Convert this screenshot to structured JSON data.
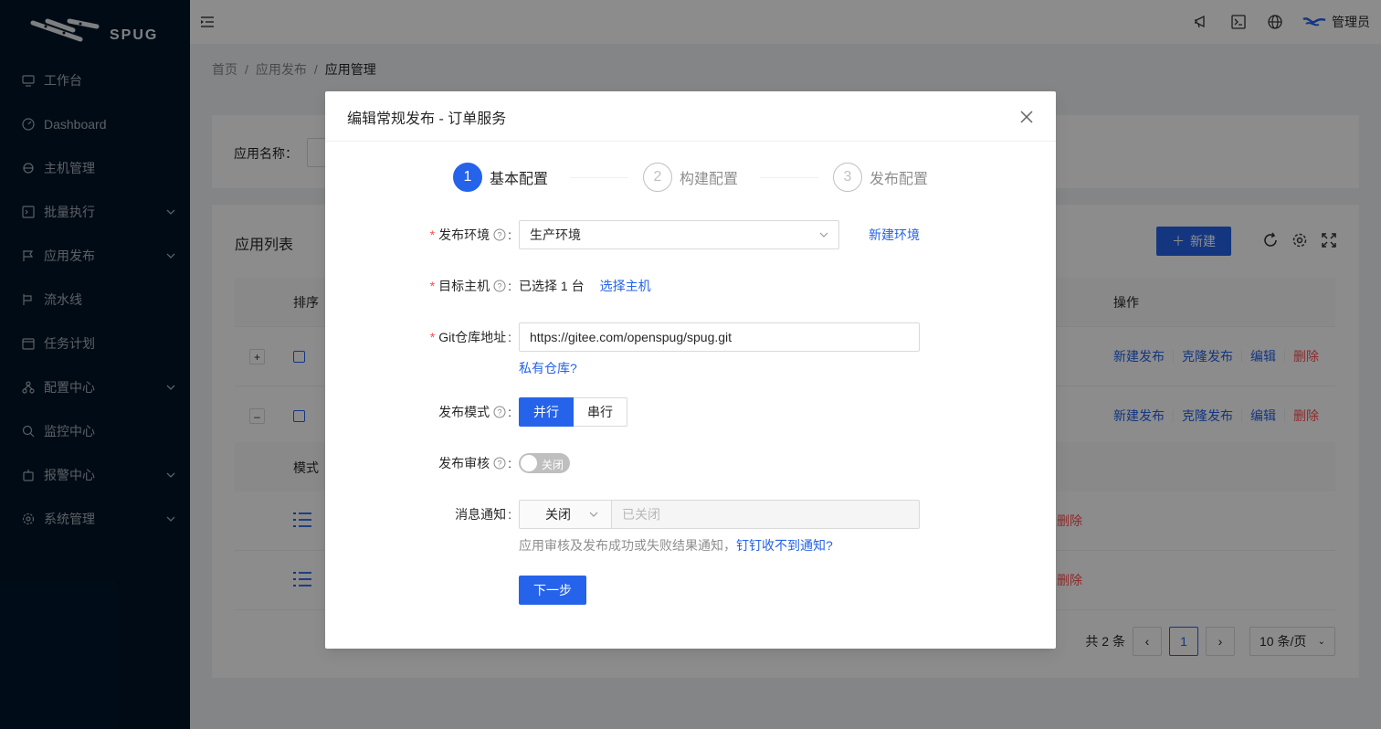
{
  "app": {
    "logo_text": "SPUG"
  },
  "sidebar": {
    "items": [
      {
        "label": "工作台",
        "icon": "desktop-icon",
        "has_arrow": false
      },
      {
        "label": "Dashboard",
        "icon": "dashboard-icon",
        "has_arrow": false
      },
      {
        "label": "主机管理",
        "icon": "cloud-server-icon",
        "has_arrow": false
      },
      {
        "label": "批量执行",
        "icon": "code-icon",
        "has_arrow": true
      },
      {
        "label": "应用发布",
        "icon": "flag-icon",
        "has_arrow": true
      },
      {
        "label": "流水线",
        "icon": "pipeline-icon",
        "has_arrow": false
      },
      {
        "label": "任务计划",
        "icon": "schedule-icon",
        "has_arrow": false
      },
      {
        "label": "配置中心",
        "icon": "deployment-icon",
        "has_arrow": true
      },
      {
        "label": "监控中心",
        "icon": "monitor-icon",
        "has_arrow": false
      },
      {
        "label": "报警中心",
        "icon": "alert-icon",
        "has_arrow": true
      },
      {
        "label": "系统管理",
        "icon": "setting-icon",
        "has_arrow": true
      }
    ]
  },
  "header": {
    "user": "管理员"
  },
  "breadcrumb": {
    "items": [
      "首页",
      "应用发布",
      "应用管理"
    ]
  },
  "search": {
    "label": "应用名称："
  },
  "list": {
    "title": "应用列表",
    "new_label": "新建",
    "col_sort": "排序",
    "col_ops": "操作",
    "row_actions": [
      "新建发布",
      "克隆发布",
      "编辑",
      "删除"
    ],
    "row_expand": [
      "+",
      "–"
    ],
    "sub_col_mode": "模式",
    "sub_delete": "删除",
    "pager": {
      "total": "共 2 条",
      "page": "1",
      "size": "10 条/页"
    }
  },
  "modal": {
    "title": "编辑常规发布 - 订单服务",
    "steps": [
      {
        "num": "1",
        "title": "基本配置",
        "active": true
      },
      {
        "num": "2",
        "title": "构建配置",
        "active": false
      },
      {
        "num": "3",
        "title": "发布配置",
        "active": false
      }
    ],
    "env": {
      "label": "发布环境",
      "value": "生产环境",
      "link": "新建环境"
    },
    "host": {
      "label": "目标主机",
      "value": "已选择 1 台",
      "link": "选择主机"
    },
    "git": {
      "label": "Git仓库地址",
      "value": "https://gitee.com/openspug/spug.git",
      "link": "私有仓库?"
    },
    "mode": {
      "label": "发布模式",
      "options": [
        "并行",
        "串行"
      ],
      "selected": "并行"
    },
    "review": {
      "label": "发布审核",
      "switch_text": "关闭"
    },
    "notify": {
      "label": "消息通知",
      "select_value": "关闭",
      "input_placeholder": "已关闭",
      "help": "应用审核及发布成功或失败结果通知，",
      "help_link": "钉钉收不到通知?"
    },
    "next_label": "下一步"
  },
  "colors": {
    "primary": "#2563eb",
    "danger": "#ff4d4f",
    "sidebar_bg": "#001529"
  }
}
